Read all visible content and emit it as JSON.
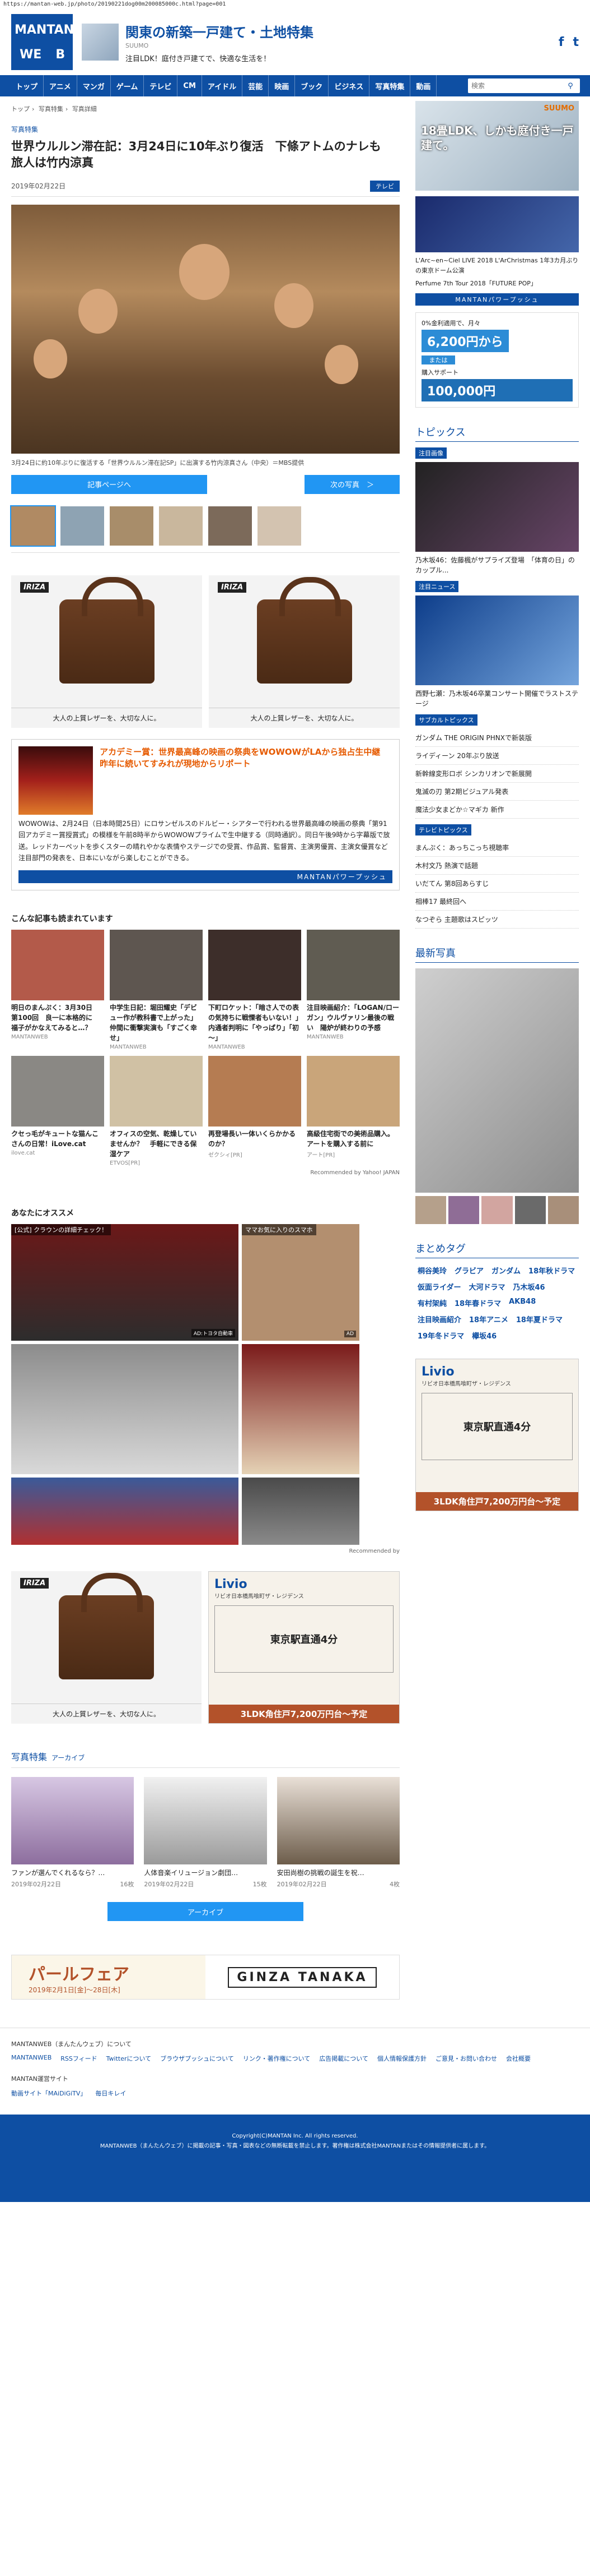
{
  "browser": {
    "url": "https://mantan-web.jp/photo/20190221dog00m200085000c.html?page=001"
  },
  "header": {
    "logo": [
      "MAN",
      "TAN",
      "WE",
      "B"
    ],
    "ad_title": "関東の新築一戸建て・土地特集",
    "ad_sub": "SUUMO",
    "ad_desc": "注目LDK！庭付き戸建てで、快適な生活を！",
    "social": [
      "f",
      "t"
    ]
  },
  "nav": {
    "items": [
      "トップ",
      "アニメ",
      "マンガ",
      "ゲーム",
      "テレビ",
      "CM",
      "アイドル",
      "芸能",
      "映画",
      "ブック",
      "ビジネス",
      "写真特集",
      "動画"
    ],
    "search_placeholder": "検索"
  },
  "breadcrumb": [
    "トップ",
    "写真特集",
    "写真詳細"
  ],
  "article": {
    "section": "写真特集",
    "title": "世界ウルルン滞在記：3月24日に10年ぶり復活　下條アトムのナレも　旅人は竹内涼真",
    "date": "2019年02月22日",
    "tag": "テレビ",
    "caption": "3月24日に約10年ぶりに復活する「世界ウルルン滞在記SP」に出演する竹内涼真さん（中央）＝MBS提供",
    "prev_btn": "記事ページへ",
    "next_btn": "次の写真　＞"
  },
  "ads": {
    "bag_brand": "IRIZA",
    "bag_caption": "大人の上質レザーを、大切な人に。"
  },
  "promo": {
    "title": "アカデミー賞：世界最高峰の映画の祭典をWOWOWがLAから独占生中継　昨年に続いてすみれが現地からリポート",
    "text": "WOWOWは、2月24日（日本時間25日）にロサンゼルスのドルビー・シアターで行われる世界最高峰の映画の祭典「第91回アカデミー賞授賞式」の模様を午前8時半からWOWOWプライムで生中継する（同時通訳）。同日午後9時から字幕版で放送。レッドカーペットを歩くスターの晴れやかな表情やステージでの受賞、作品賞、監督賞、主演男優賞、主演女優賞など注目部門の発表を、日本にいながら楽しむことができる。",
    "foot": "MANTANパワープッシュ"
  },
  "recommend": {
    "title": "こんな記事も読まれています",
    "items": [
      {
        "text": "明日のまんぷく：3月30日　第100回　良一に本格的に　福子がかなえてみると…？",
        "src": "MANTANWEB"
      },
      {
        "text": "中学生日記：堀田耀史「デビュー作が教科書で上がった」　仲間に衝撃実演も「すごく幸せ」",
        "src": "MANTANWEB"
      },
      {
        "text": "下町ロケット：「暗さ人での表の気持ちに戦慄者もいない！」　内通者判明に「やっぱり」「初～」",
        "src": "MANTANWEB"
      },
      {
        "text": "注目映画紹介：「LOGAN/ローガン」ウルヴァリン最後の戦い　陽炉が終わりの予感",
        "src": "MANTANWEB"
      },
      {
        "text": "クセっ毛がキュートな猫んこさんの日常！iLove.cat",
        "src": "ilove.cat"
      },
      {
        "text": "オフィスの空気、乾燥していませんか？　手軽にできる保湿ケア",
        "src": "ETVOS[PR]"
      },
      {
        "text": "再登場長い一体いくらかかるのか？",
        "src": "ゼクシィ[PR]"
      },
      {
        "text": "高級住宅街での美術品購入。アートを購入する前に",
        "src": "アート[PR]"
      }
    ],
    "recommended_by": "Recommended by Yahoo! JAPAN"
  },
  "osusume": {
    "title": "あなたにオススメ",
    "items": [
      {
        "label": "[公式] クラウンの詳細チェック！",
        "sub": "AD:トヨタ自動車"
      },
      {
        "label": "ママお気に入りのスマホ",
        "sub": "AD"
      },
      {
        "label": "",
        "sub": ""
      },
      {
        "label": "",
        "sub": ""
      }
    ],
    "recommended_by": "Recommended by"
  },
  "livio": {
    "name": "Livio",
    "sub": "リビオ日本橋馬喰町ザ・レジデンス",
    "map": "東京駅直通4分",
    "price": "3LDK角住戸7,200万円台〜予定"
  },
  "archive": {
    "title": "写真特集",
    "sub": "アーカイブ",
    "items": [
      {
        "text": "ファンが選んでくれるなら？…",
        "date": "2019年02月22日",
        "count": "16枚"
      },
      {
        "text": "人体音楽イリュージョン劇団…",
        "date": "2019年02月22日",
        "count": "15枚"
      },
      {
        "text": "安田尚樹の挑戦の誕生を祝…",
        "date": "2019年02月22日",
        "count": "4枚"
      }
    ],
    "btn": "アーカイブ"
  },
  "bottom_banner": {
    "title": "パールフェア",
    "date": "2019年2月1日[金]〜28日[木]",
    "brand": "GINZA TANAKA"
  },
  "side": {
    "ad_brand": "SUUMO",
    "ad_copy": "18畳LDK、しかも庭付き一戸建て。",
    "pr_text": "L'Arc~en~Ciel LIVE 2018 L'ArChristmas 1年3カ月ぶりの東京ドーム公演",
    "pr_text2": "Perfume 7th Tour 2018「FUTURE POP」",
    "pr_foot": "MANTANパワープッシュ",
    "peugeot_label": "0%金利適用で、月々",
    "peugeot_price": "6,200円から",
    "peugeot_or": "または",
    "peugeot_label2": "購入サポート",
    "peugeot_big": "100,000円",
    "topics_title": "トピックス",
    "topic_tag": "注目画像",
    "topic_text": "乃木坂46：佐藤楓がサプライズ登場　「体育の日」のカップル...",
    "topic_tag2": "注目ニュース",
    "topic_text2": "西野七瀬：乃木坂46卒業コンサート開催でラストステージ",
    "culture_tag": "サブカルトピックス",
    "culture_links": [
      "ガンダム THE ORIGIN PHNXで新装版",
      "ライディーン 20年ぶり放送",
      "新幹線変形ロボ シンカリオンで新展開",
      "鬼滅の刃 第2期ビジュアル発表",
      "魔法少女まどか☆マギカ 新作"
    ],
    "tv_tag": "テレビトピックス",
    "tv_links": [
      "まんぷく：あっちこっち視聴率",
      "木村文乃 熱演で話題",
      "いだてん 第8回あらすじ",
      "相棒17 最終回へ",
      "なつぞら 主題歌はスピッツ"
    ],
    "photo_title": "最新写真",
    "summary_title": "まとめタグ",
    "tags": [
      "桐谷美玲",
      "グラビア",
      "ガンダム",
      "18年秋ドラマ",
      "仮面ライダー",
      "大河ドラマ",
      "乃木坂46",
      "有村架純",
      "18年春ドラマ",
      "AKB48",
      "注目映画紹介",
      "18年アニメ",
      "18年夏ドラマ",
      "19年冬ドラマ",
      "欅坂46"
    ]
  },
  "footer": {
    "about": "MANTANWEB（まんたんウェブ）について",
    "links": [
      "MANTANWEB",
      "RSSフィード",
      "Twitterについて",
      "ブラウザプッシュについて",
      "リンク・著作権について",
      "広告掲載について",
      "個人情報保護方針",
      "ご意見・お問い合わせ",
      "会社概要"
    ],
    "sites_label": "MANTAN運営サイト",
    "sites": [
      "動画サイト「MAiDiGiTV」",
      "毎日キレイ"
    ],
    "copyright": "Copyright(C)MANTAN Inc. All rights reserved.",
    "note": "MANTANWEB（まんたんウェブ）に掲載の記事・写真・図表などの無断転載を禁止します。著作権は株式会社MANTANまたはその情報提供者に属します。"
  }
}
